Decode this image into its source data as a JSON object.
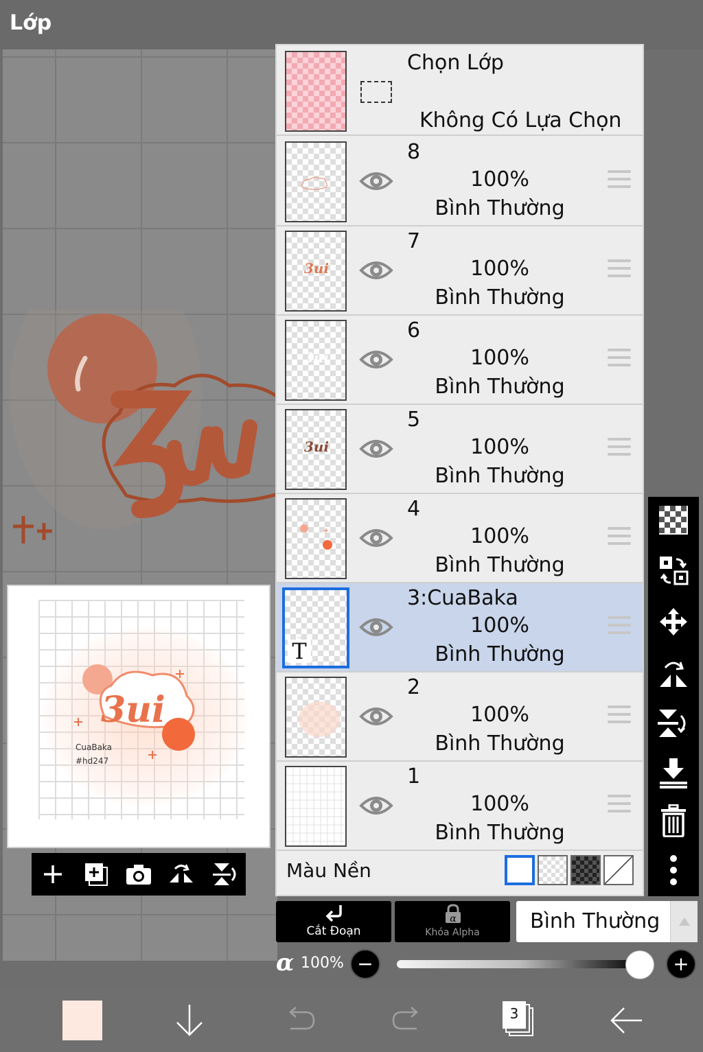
{
  "title": "Lớp",
  "selection": {
    "title": "Chọn Lớp",
    "subtitle": "Không Có Lựa Chọn"
  },
  "layers": [
    {
      "name": "8",
      "opacity": "100%",
      "blend": "Bình Thường"
    },
    {
      "name": "7",
      "opacity": "100%",
      "blend": "Bình Thường"
    },
    {
      "name": "6",
      "opacity": "100%",
      "blend": "Bình Thường"
    },
    {
      "name": "5",
      "opacity": "100%",
      "blend": "Bình Thường"
    },
    {
      "name": "4",
      "opacity": "100%",
      "blend": "Bình Thường"
    },
    {
      "name": "3:CuaBaka",
      "opacity": "100%",
      "blend": "Bình Thường"
    },
    {
      "name": "2",
      "opacity": "100%",
      "blend": "Bình Thường"
    },
    {
      "name": "1",
      "opacity": "100%",
      "blend": "Bình Thường"
    }
  ],
  "active_layer": "3:CuaBaka",
  "background_color_label": "Màu Nền",
  "text_layer_badge": "T",
  "preview": {
    "art_text": "3ui",
    "credit_line1": "CuaBaka",
    "credit_line2": "#hd247"
  },
  "clip_button_label": "Cắt Đoạn",
  "alpha_lock_label": "Khóa Alpha",
  "blend_mode_value": "Bình Thường",
  "alpha_symbol": "α",
  "layer_opacity": "100%",
  "layer_opacity_fraction": 0.95,
  "layer_count": "3",
  "current_color": "#fde9e0",
  "accent_color": "#1c6de0",
  "icons": {
    "preview_toolbar": [
      "plus-icon",
      "add-layer-icon",
      "camera-icon",
      "flip-horizontal-icon",
      "flip-vertical-icon"
    ],
    "right_toolbar": [
      "transparency-icon",
      "layer-swap-icon",
      "move-icon",
      "flip-rotate-icon",
      "flip-vertical-rotate-icon",
      "merge-down-icon",
      "trash-icon",
      "more-icon"
    ],
    "bottom_bar": [
      "color-swatch",
      "download-icon",
      "undo-icon",
      "redo-icon",
      "layers-icon",
      "back-arrow-icon"
    ]
  }
}
